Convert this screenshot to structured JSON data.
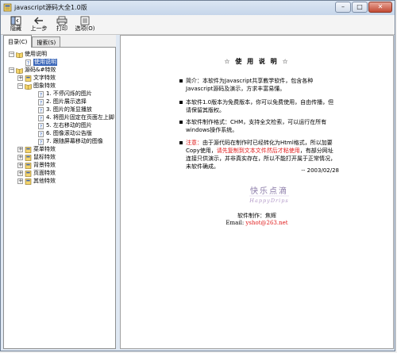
{
  "window": {
    "title": "javascript源码大全1.0版",
    "buttons": {
      "minimize": "–",
      "maximize": "□",
      "close": "✕"
    }
  },
  "toolbar": {
    "hide": "隐藏",
    "back": "上一步",
    "print": "打印",
    "options": "选项(O)"
  },
  "left_pane": {
    "tabs": [
      "目录(C)",
      "搜索(S)"
    ],
    "tree": {
      "root1": "使用说明",
      "root1_child": "使用说明",
      "root2": "源码&#特效",
      "text_effects": "文字特效",
      "image_effects": "图象特效",
      "image_items": [
        "1. 不停闪烁的图片",
        "2. 图片展示选择",
        "3. 图片的渐显播放",
        "4. 将图片固定在页面左上脚",
        "5. 左右移动的图片",
        "6. 图像滚动公告版",
        "7. 跟随屏幕移动的图像"
      ],
      "other_categories": [
        "菜单特效",
        "鼠标特效",
        "背景特效",
        "页面特效",
        "其他特效"
      ]
    }
  },
  "content": {
    "title": "☆ 使 用 说 明 ☆",
    "para1": "简介：本软件为Javascript共享教学软件，包含各种Javascript源码及演示，方求丰富易懂。",
    "para2": "本软件1.0版本为免费版本，你可以免费使用，自由传播，但请保留其版权。",
    "para3": "本软件制作格式：CHM，支持全文检索，可以运行在所有windows操作系统。",
    "note_label": "注意：",
    "note_text1": "由于源代码在制作时已经转化为Html格式，所以加要Copy使用，",
    "note_red": "请先复制到文本文件然后才粘使用",
    "note_text2": "，有部分网址连接只供演示，并非真实存在，所以不能打开属于正常情况，未软件确成。",
    "date": "-- 2003/02/28",
    "logo_cn": "快乐点滴",
    "logo_en": "HappyDrips",
    "author": "软件制作：焦辉",
    "email_label": "Email:",
    "email": "yshot@263.net"
  }
}
